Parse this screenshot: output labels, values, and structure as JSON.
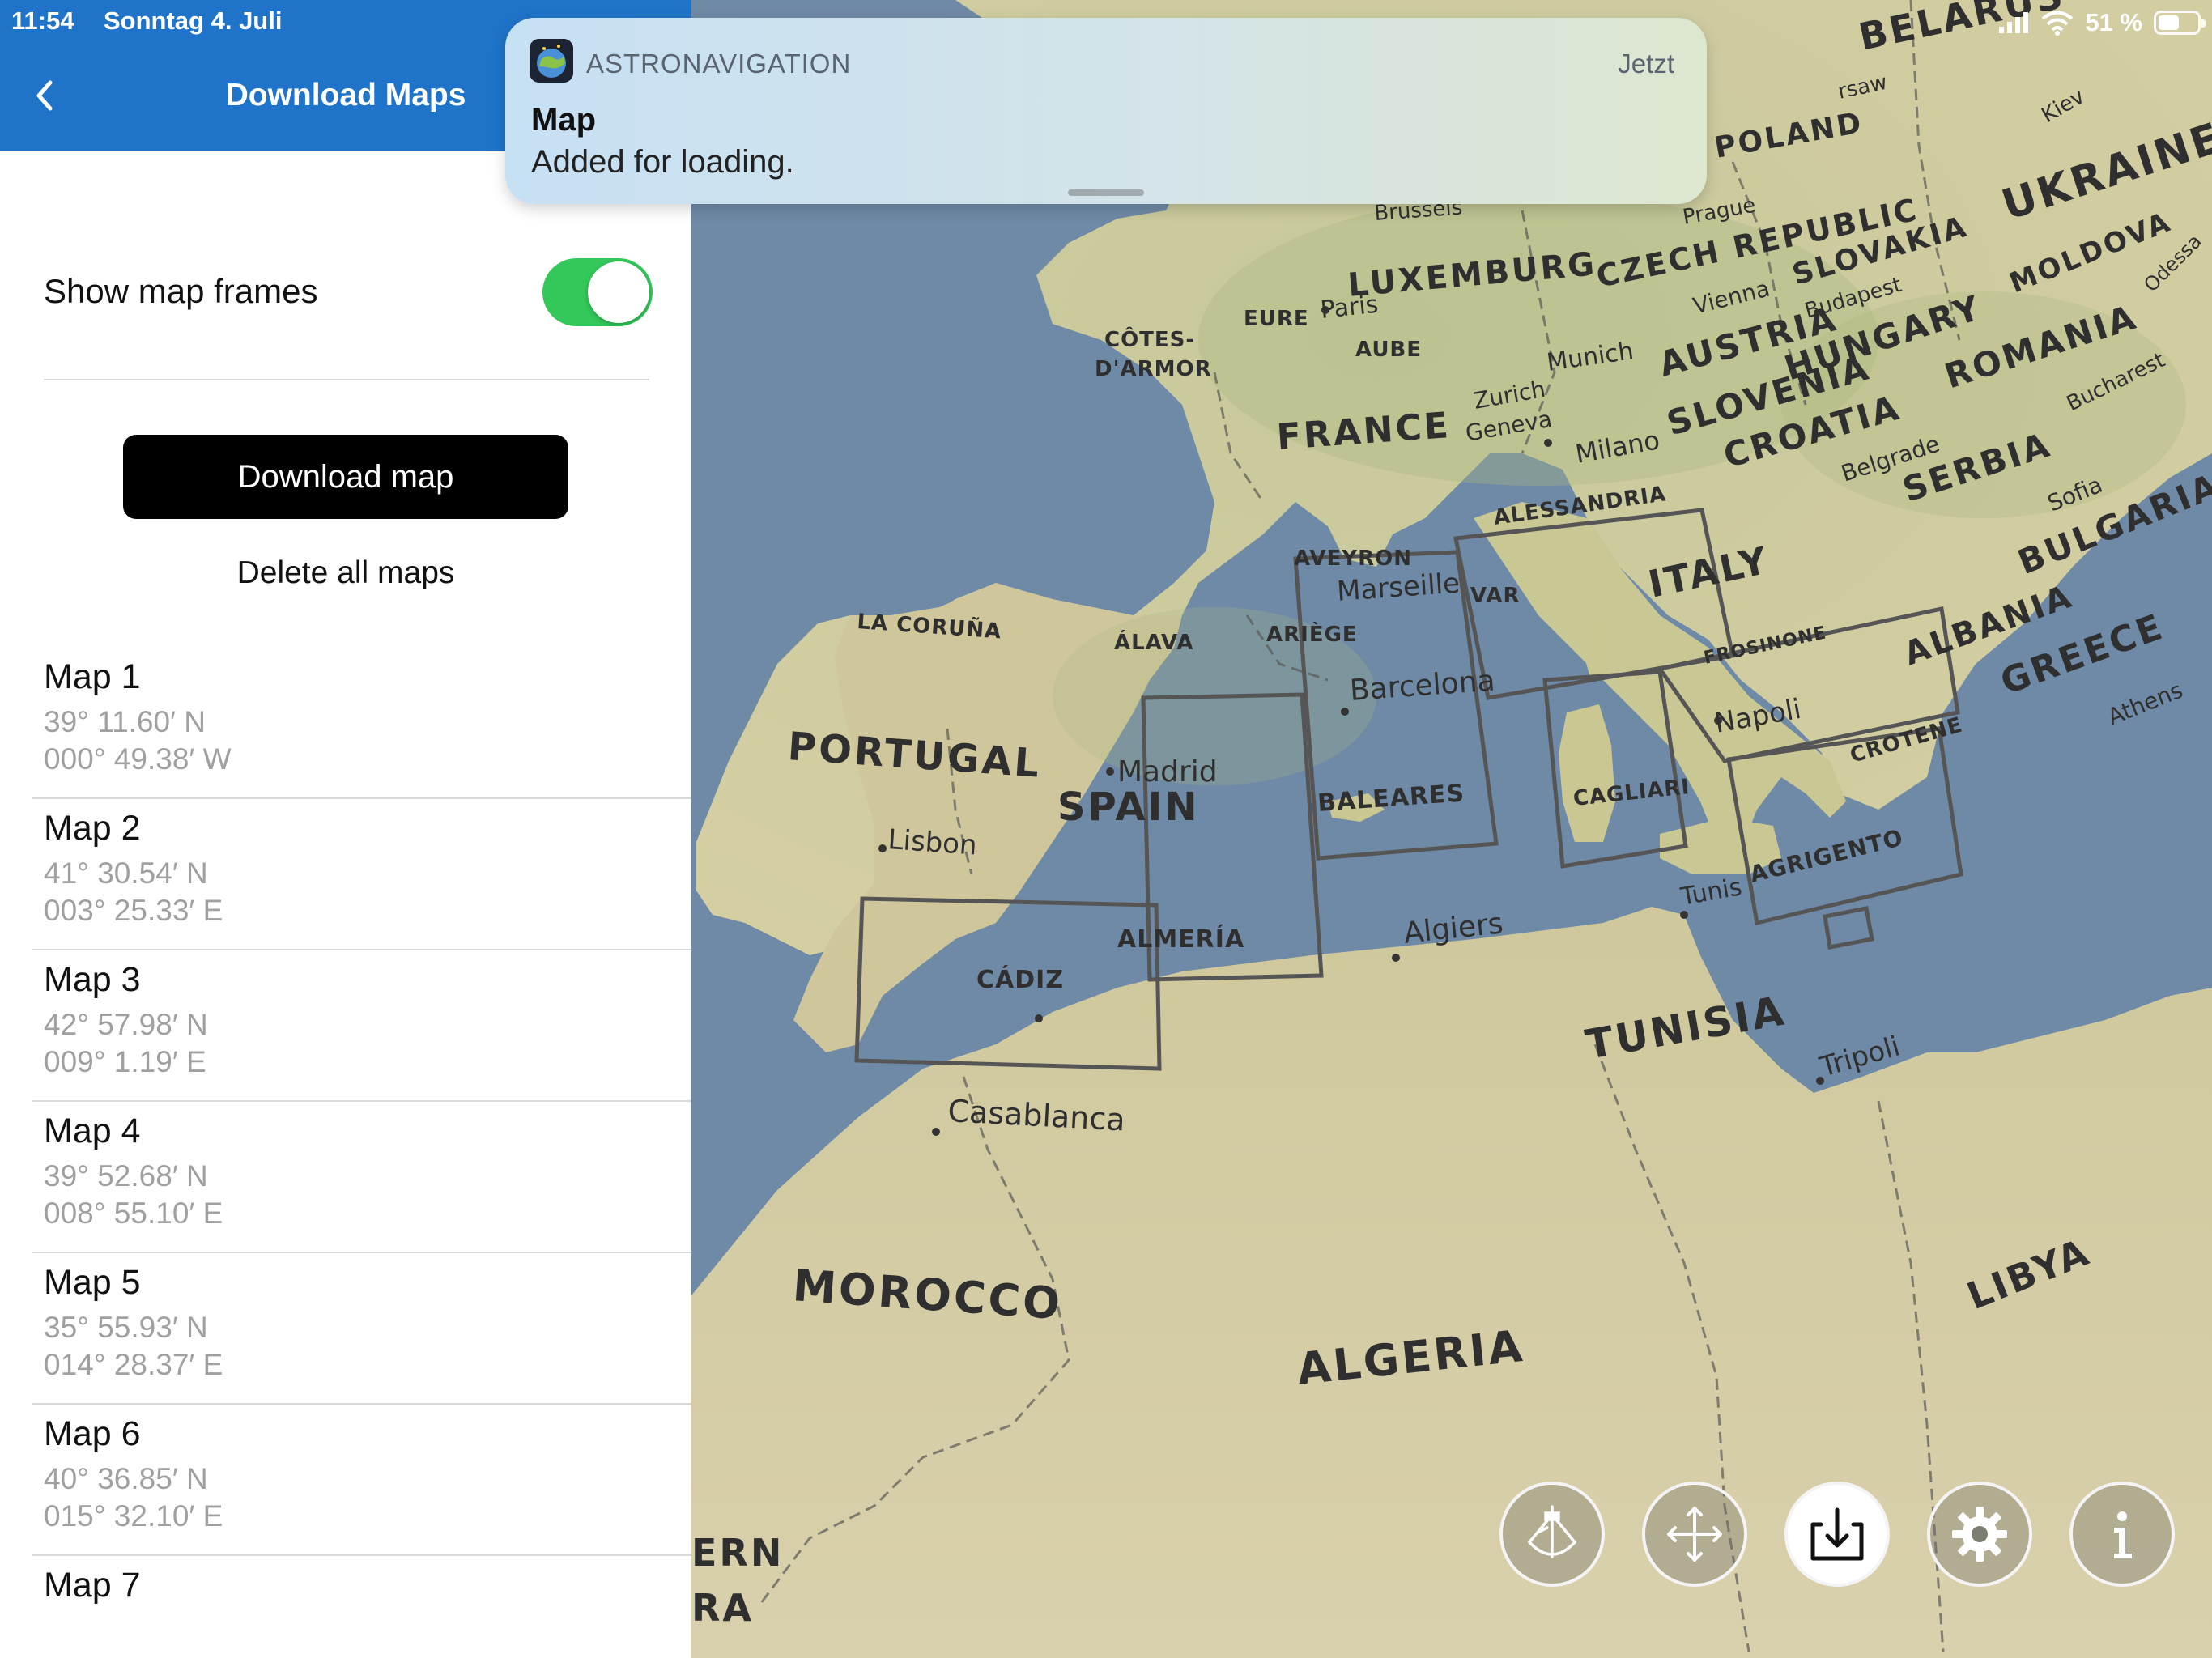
{
  "status_bar": {
    "time": "11:54",
    "date": "Sonntag 4. Juli",
    "battery": "51 %"
  },
  "navbar": {
    "title": "Download Maps",
    "color": "#1f74c9"
  },
  "settings": {
    "show_frames_label": "Show map frames",
    "show_frames_enabled": true
  },
  "actions": {
    "download_label": "Download map",
    "delete_label": "Delete all maps"
  },
  "maps": [
    {
      "name": "Map 1",
      "lat": "39°  11.60′ N",
      "lon": "000°  49.38′ W"
    },
    {
      "name": "Map 2",
      "lat": "41°  30.54′ N",
      "lon": "003°  25.33′ E"
    },
    {
      "name": "Map 3",
      "lat": "42°  57.98′ N",
      "lon": "009°  1.19′ E"
    },
    {
      "name": "Map 4",
      "lat": "39°  52.68′ N",
      "lon": "008°  55.10′ E"
    },
    {
      "name": "Map 5",
      "lat": "35°  55.93′ N",
      "lon": "014°  28.37′ E"
    },
    {
      "name": "Map 6",
      "lat": "40°  36.85′ N",
      "lon": "015°  32.10′ E"
    },
    {
      "name": "Map 7",
      "lat": "",
      "lon": ""
    }
  ],
  "notification": {
    "app": "ASTRONAVIGATION",
    "time": "Jetzt",
    "title": "Map",
    "body": "Added for loading."
  },
  "map_labels": {
    "countries": {
      "belarus": "BELARUS",
      "poland": "POLAND",
      "ukraine": "UKRAINE",
      "moldova": "MOLDOVA",
      "luxemburg": "LUXEMBURG",
      "czech": "CZECH REPUBLIC",
      "slovakia": "SLOVAKIA",
      "austria": "AUSTRIA",
      "hungary": "HUNGARY",
      "romania": "ROMANIA",
      "france": "FRANCE",
      "slovenia": "SLOVENIA",
      "croatia": "CROATIA",
      "serbia": "SERBIA",
      "bulgaria": "BULGARIA",
      "italy": "ITALY",
      "albania": "ALBANIA",
      "greece": "GREECE",
      "portugal": "PORTUGAL",
      "spain": "SPAIN",
      "tunisia": "TUNISIA",
      "morocco": "MOROCCO",
      "algeria": "ALGERIA",
      "libya": "LIBYA",
      "western_sahara_1": "ERN",
      "western_sahara_2": "RA"
    },
    "cities": {
      "warsaw": "rsaw",
      "kiev": "Kiev",
      "brussels": "Brussels",
      "prague": "Prague",
      "odessa": "Odessa",
      "paris": "Paris",
      "vienna": "Vienna",
      "budapest": "Budapest",
      "munich": "Munich",
      "bucharest": "Bucharest",
      "zurich": "Zurich",
      "geneva": "Geneva",
      "milano": "Milano",
      "belgrade": "Belgrade",
      "sofia": "Sofia",
      "marseille": "Marseille",
      "barcelona": "Barcelona",
      "napoli": "Napoli",
      "athens": "Athens",
      "madrid": "Madrid",
      "lisbon": "Lisbon",
      "tunis": "Tunis",
      "algiers": "Algiers",
      "tripoli": "Tripoli",
      "casablanca": "Casablanca"
    },
    "regions": {
      "eure": "EURE",
      "cotes1": "CÔTES-",
      "cotes2": "D'ARMOR",
      "aube": "AUBE",
      "alessandria": "ALESSANDRIA",
      "aveyron": "AVEYRON",
      "var": "VAR",
      "ariege": "ARIÈGE",
      "la_coruna": "LA CORUÑA",
      "alava": "ÁLAVA",
      "frosinone": "FROSINONE",
      "crotene": "CROTENE",
      "cagliari": "CAGLIARI",
      "baleares": "BALEARES",
      "agrigento": "AGRIGENTO",
      "almeria": "ALMERÍA",
      "cadiz": "CÁDIZ"
    }
  },
  "toolbar": {
    "buttons": [
      {
        "icon": "sextant-icon",
        "active": false
      },
      {
        "icon": "move-icon",
        "active": false
      },
      {
        "icon": "download-icon",
        "active": true
      },
      {
        "icon": "gear-icon",
        "active": false
      },
      {
        "icon": "info-icon",
        "active": false
      }
    ]
  },
  "colors": {
    "sea": "#6f8aa6",
    "land": "#cfcba0",
    "toggle_on": "#34c759",
    "frame": "#555555"
  }
}
